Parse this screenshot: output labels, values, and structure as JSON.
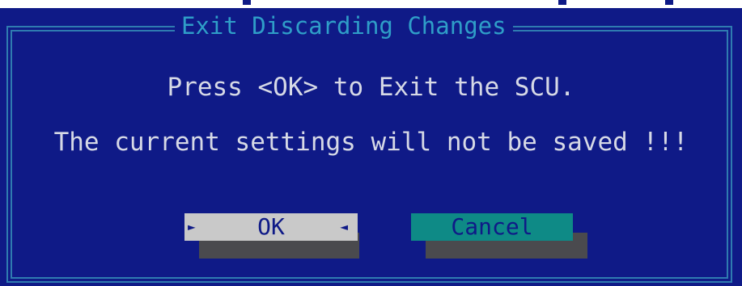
{
  "dialog": {
    "title": "Exit Discarding Changes",
    "message_line1": "Press <OK> to Exit the SCU.",
    "message_line2": "The current settings will not be saved !!!"
  },
  "buttons": {
    "ok_label": "OK",
    "cancel_label": "Cancel",
    "focused": "OK"
  },
  "icons": {
    "focus_left": "triangle-right-icon",
    "focus_right": "triangle-left-icon"
  },
  "colors": {
    "background": "#0f1a87",
    "frame": "#2f7bb0",
    "title_text": "#2f9ec8",
    "message_text": "#d6d9e6",
    "ok_button_bg": "#c9c9c9",
    "cancel_button_bg": "#0e8a86",
    "button_shadow": "#4a4a4e"
  }
}
